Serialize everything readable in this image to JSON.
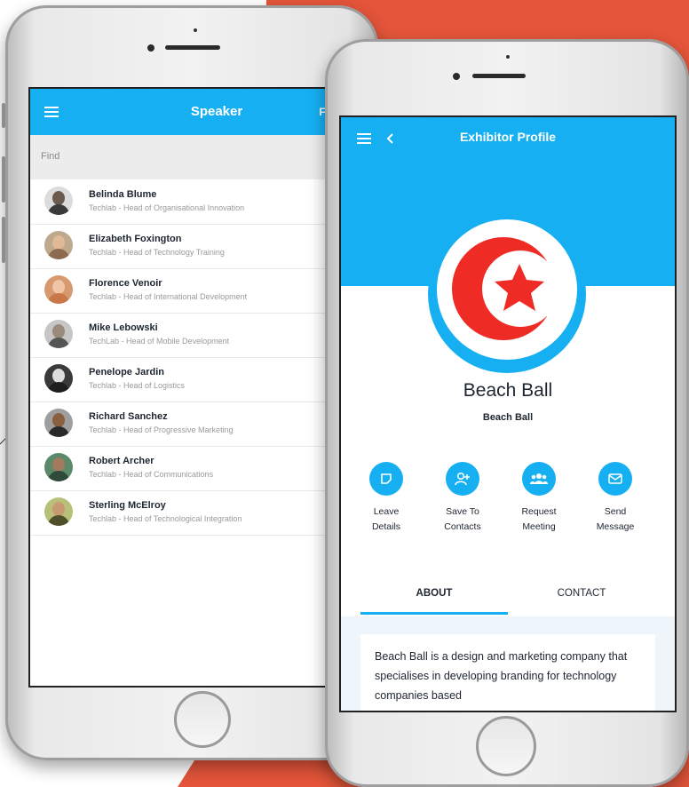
{
  "left_app": {
    "title": "Speaker",
    "title_overflow": "F",
    "find_placeholder": "Find",
    "speakers": [
      {
        "name": "Belinda Blume",
        "subtitle": "Techlab - Head of Organisational Innovation"
      },
      {
        "name": "Elizabeth Foxington",
        "subtitle": "Techlab - Head of Technology Training"
      },
      {
        "name": "Florence Venoir",
        "subtitle": "Techlab - Head of International Development"
      },
      {
        "name": "Mike Lebowski",
        "subtitle": "TechLab - Head of Mobile Development"
      },
      {
        "name": "Penelope Jardin",
        "subtitle": "Techlab - Head of Logistics"
      },
      {
        "name": "Richard Sanchez",
        "subtitle": "Techlab - Head of Progressive Marketing"
      },
      {
        "name": "Robert Archer",
        "subtitle": "Techlab - Head of Communications"
      },
      {
        "name": "Sterling McElroy",
        "subtitle": "Techlab - Head of Technological Integration"
      }
    ]
  },
  "right_app": {
    "title": "Exhibitor Profile",
    "company_name": "Beach Ball",
    "company_subtitle": "Beach Ball",
    "actions": [
      {
        "line1": "Leave",
        "line2": "Details",
        "icon": "note-icon"
      },
      {
        "line1": "Save To",
        "line2": "Contacts",
        "icon": "add-contact-icon"
      },
      {
        "line1": "Request",
        "line2": "Meeting",
        "icon": "group-icon"
      },
      {
        "line1": "Send",
        "line2": "Message",
        "icon": "mail-icon"
      }
    ],
    "tabs": {
      "about": "ABOUT",
      "contact": "CONTACT"
    },
    "about_text": "Beach Ball is a design and marketing company that specialises in developing branding for technology companies based"
  },
  "colors": {
    "accent": "#16b0f2",
    "background_orange": "#e4553a",
    "logo_red": "#ee2b24"
  }
}
